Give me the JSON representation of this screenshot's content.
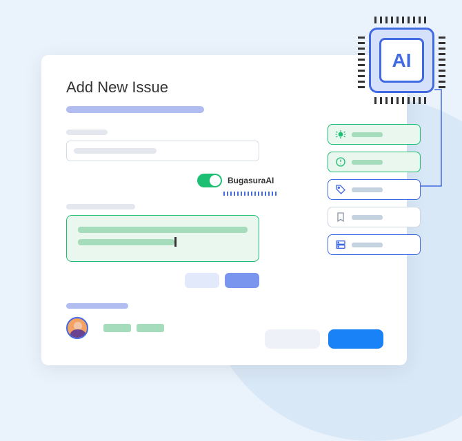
{
  "page_title": "Add New Issue",
  "ai_toggle_label": "BugasuraAI",
  "ai_toggle_on": true,
  "ai_chip_label": "AI",
  "suggestion_cards": [
    {
      "icon": "bug",
      "style": "green"
    },
    {
      "icon": "alert",
      "style": "green"
    },
    {
      "icon": "tag",
      "style": "blue"
    },
    {
      "icon": "bookmark",
      "style": "gray"
    },
    {
      "icon": "server",
      "style": "blue"
    }
  ],
  "colors": {
    "primary_blue": "#4169e1",
    "accent_blue": "#1a82f7",
    "green": "#1dbf73",
    "soft_blue": "#b1bdf0",
    "bg": "#eaf2fb"
  }
}
